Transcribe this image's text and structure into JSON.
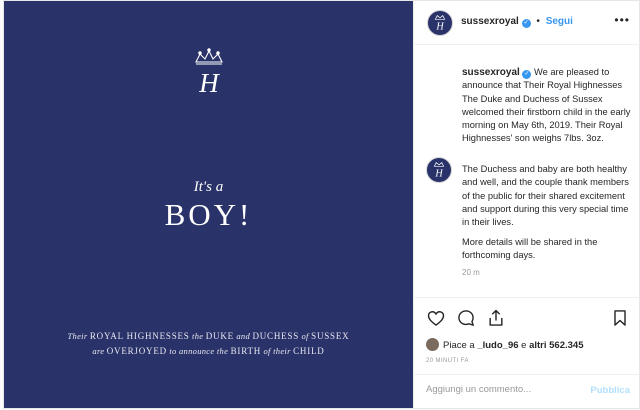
{
  "post": {
    "image": {
      "headline_small": "It's a",
      "headline_big": "BOY!",
      "caption_line1": [
        {
          "text": "Their ",
          "style": "it"
        },
        {
          "text": "ROYAL HIGHNESSES",
          "style": "caps"
        },
        {
          "text": " the ",
          "style": "it"
        },
        {
          "text": "DUKE",
          "style": "caps"
        },
        {
          "text": " and ",
          "style": "it"
        },
        {
          "text": "DUCHESS",
          "style": "caps"
        },
        {
          "text": " of ",
          "style": "it"
        },
        {
          "text": "SUSSEX",
          "style": "caps"
        }
      ],
      "caption_line2": [
        {
          "text": "are ",
          "style": "it"
        },
        {
          "text": "OVERJOYED",
          "style": "caps"
        },
        {
          "text": " to announce the ",
          "style": "it"
        },
        {
          "text": "BIRTH",
          "style": "caps"
        },
        {
          "text": " of their ",
          "style": "it"
        },
        {
          "text": "CHILD",
          "style": "caps"
        }
      ],
      "background_color": "#2a3369",
      "monogram": "H"
    },
    "header": {
      "username": "sussexroyal",
      "separator": "•",
      "follow_label": "Segui",
      "more_icon": "•••"
    },
    "caption": {
      "username": "sussexroyal",
      "text": "We are pleased to announce that Their Royal Highnesses The Duke and Duchess of Sussex welcomed their firstborn child in the early morning on May 6th, 2019. Their Royal Highnesses' son weighs 7lbs. 3oz."
    },
    "comment": {
      "paragraph1": "The Duchess and baby are both healthy and well, and the couple thank members of the public for their shared excitement and support during this very special time in their lives.",
      "paragraph2": "More details will be shared in the forthcoming days.",
      "time": "20 m"
    },
    "likes": {
      "prefix": "Piace a ",
      "user": "_ludo_96",
      "middle": " e ",
      "others": "altri 562.345"
    },
    "posted_time": "20 MINUTI FA",
    "add_comment": {
      "placeholder": "Aggiungi un commento...",
      "publish_label": "Pubblica"
    }
  },
  "colors": {
    "navy": "#2a3369",
    "link_blue": "#3897f0",
    "publish_disabled": "#b2dffc",
    "muted": "#999999"
  },
  "icons": [
    "heart-icon",
    "comment-icon",
    "share-icon",
    "bookmark-icon",
    "verified-badge-icon",
    "more-options-icon",
    "crown-monogram-icon"
  ]
}
